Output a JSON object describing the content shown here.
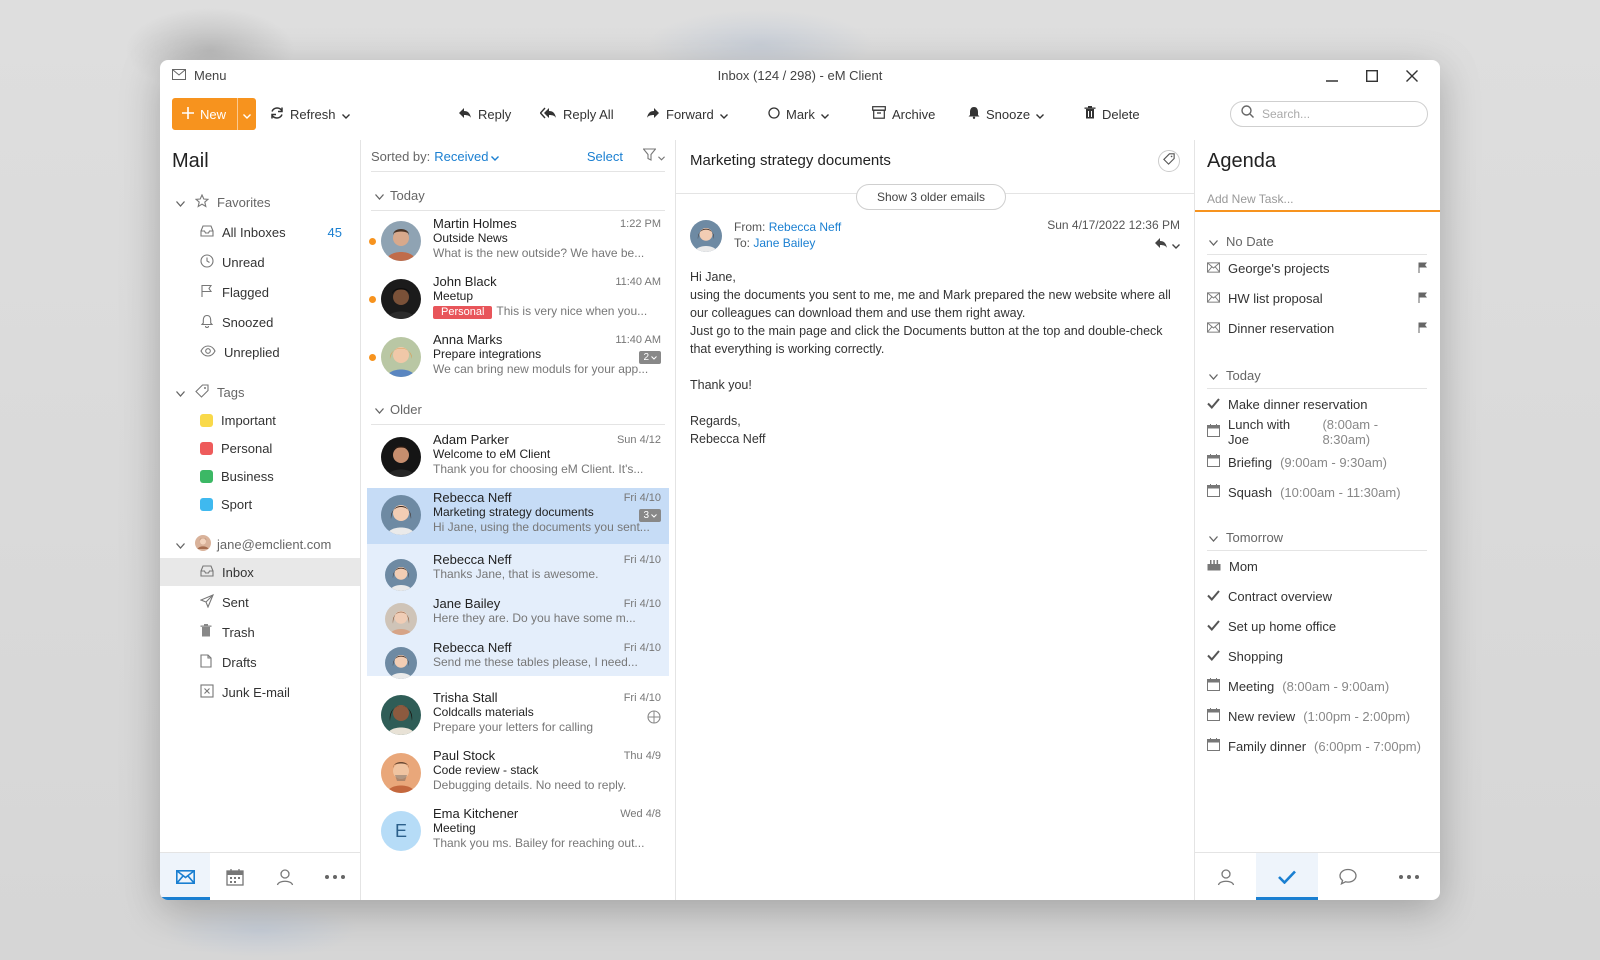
{
  "window": {
    "menu_label": "Menu",
    "title": "Inbox (124 / 298) - eM Client"
  },
  "toolbar": {
    "new_label": "New",
    "refresh_label": "Refresh",
    "reply_label": "Reply",
    "reply_all_label": "Reply All",
    "forward_label": "Forward",
    "mark_label": "Mark",
    "archive_label": "Archive",
    "snooze_label": "Snooze",
    "delete_label": "Delete",
    "search_placeholder": "Search..."
  },
  "sidebar": {
    "title": "Mail",
    "favorites_label": "Favorites",
    "favorites": [
      {
        "label": "All Inboxes",
        "count": "45",
        "icon": "inbox-icon"
      },
      {
        "label": "Unread",
        "icon": "clock-icon"
      },
      {
        "label": "Flagged",
        "icon": "flag-icon"
      },
      {
        "label": "Snoozed",
        "icon": "bell-icon"
      },
      {
        "label": "Unreplied",
        "icon": "eye-icon"
      }
    ],
    "tags_label": "Tags",
    "tags": [
      {
        "label": "Important",
        "color": "#f9d94a"
      },
      {
        "label": "Personal",
        "color": "#ee5b5b"
      },
      {
        "label": "Business",
        "color": "#3cb865"
      },
      {
        "label": "Sport",
        "color": "#3fb9ef"
      }
    ],
    "account_label": "jane@emclient.com",
    "folders": [
      {
        "label": "Inbox",
        "icon": "inbox-icon"
      },
      {
        "label": "Sent",
        "icon": "send-icon"
      },
      {
        "label": "Trash",
        "icon": "trash-icon"
      },
      {
        "label": "Drafts",
        "icon": "draft-icon"
      },
      {
        "label": "Junk E-mail",
        "icon": "junk-icon"
      }
    ],
    "accent_color": "#1a7fd1"
  },
  "list": {
    "sorted_by_label": "Sorted by:",
    "sorted_by_value": "Received",
    "select_label": "Select",
    "group_today": "Today",
    "group_older": "Older",
    "messages": [
      {
        "from": "Martin Holmes",
        "subject": "Outside News",
        "preview": "What is the new outside? We have be...",
        "date": "1:22 PM"
      },
      {
        "from": "John Black",
        "subject": "Meetup",
        "tag": "Personal",
        "preview": "This is very nice when you...",
        "date": "11:40 AM"
      },
      {
        "from": "Anna Marks",
        "subject": "Prepare integrations",
        "preview": "We can bring new moduls for your app...",
        "date": "11:40 AM",
        "count": "2"
      },
      {
        "from": "Adam Parker",
        "subject": "Welcome to eM Client",
        "preview": "Thank you for choosing eM Client. It's...",
        "date": "Sun 4/12"
      },
      {
        "from": "Rebecca Neff",
        "subject": "Marketing strategy documents",
        "preview": "Hi Jane, using the documents you sent...",
        "date": "Fri 4/10",
        "count": "3"
      },
      {
        "from": "Rebecca Neff",
        "preview": "Thanks Jane, that is awesome.",
        "date": "Fri 4/10"
      },
      {
        "from": "Jane Bailey",
        "preview": "Here they are. Do you have some m...",
        "date": "Fri 4/10"
      },
      {
        "from": "Rebecca Neff",
        "preview": "Send me these tables please, I need...",
        "date": "Fri 4/10"
      },
      {
        "from": "Trisha Stall",
        "subject": "Coldcalls materials",
        "preview": "Prepare your letters for calling",
        "date": "Fri 4/10"
      },
      {
        "from": "Paul Stock",
        "subject": "Code review - stack",
        "preview": "Debugging details. No need to reply.",
        "date": "Thu 4/9"
      },
      {
        "from": "Ema Kitchener",
        "subject": "Meeting",
        "preview": "Thank you ms. Bailey for reaching out...",
        "date": "Wed 4/8",
        "initial": "E"
      }
    ]
  },
  "reading": {
    "subject": "Marketing strategy documents",
    "older_button": "Show 3 older emails",
    "from_label": "From:",
    "from_name": "Rebecca Neff",
    "to_label": "To:",
    "to_name": "Jane Bailey",
    "date": "Sun 4/17/2022 12:36 PM",
    "body": [
      "Hi Jane,",
      "using the documents you sent to me, me and Mark prepared the new website where all our colleagues can download them and use them right away.",
      "Just go to the main page and click the Documents button at the top and double-check that everything is working correctly.",
      "",
      "Thank you!",
      "",
      "Regards,",
      "Rebecca Neff"
    ]
  },
  "agenda": {
    "title": "Agenda",
    "add_task_placeholder": "Add New Task...",
    "no_date_label": "No Date",
    "no_date_items": [
      "George's projects",
      "HW list proposal",
      "Dinner reservation"
    ],
    "today_label": "Today",
    "today_items": [
      {
        "title": "Make dinner reservation",
        "type": "task"
      },
      {
        "title": "Lunch with Joe",
        "time": "(8:00am - 8:30am)",
        "type": "event"
      },
      {
        "title": "Briefing",
        "time": "(9:00am - 9:30am)",
        "type": "event"
      },
      {
        "title": "Squash",
        "time": "(10:00am - 11:30am)",
        "type": "event"
      }
    ],
    "tomorrow_label": "Tomorrow",
    "tomorrow_items": [
      {
        "title": "Mom",
        "type": "birthday"
      },
      {
        "title": "Contract overview",
        "type": "task"
      },
      {
        "title": "Set up home office",
        "type": "task"
      },
      {
        "title": "Shopping",
        "type": "task"
      },
      {
        "title": "Meeting",
        "time": "(8:00am - 9:00am)",
        "type": "event"
      },
      {
        "title": "New review",
        "time": "(1:00pm - 2:00pm)",
        "type": "event"
      },
      {
        "title": "Family dinner",
        "time": "(6:00pm - 7:00pm)",
        "type": "event"
      }
    ],
    "accent_color": "#f7931e"
  }
}
